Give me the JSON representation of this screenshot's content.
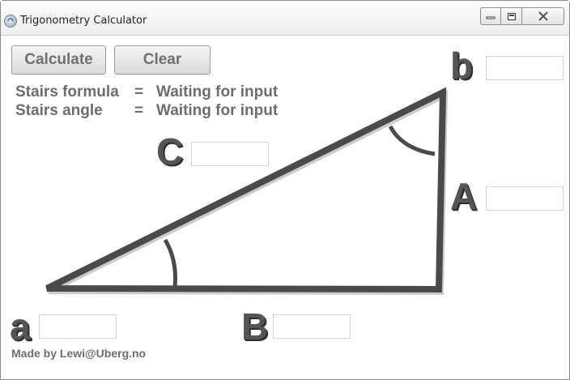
{
  "window": {
    "title": "Trigonometry Calculator",
    "icons": {
      "app": "calculator-app-icon",
      "minimize": "minimize-icon",
      "maximize": "maximize-icon",
      "close": "close-icon"
    }
  },
  "toolbar": {
    "calculate_label": "Calculate",
    "clear_label": "Clear"
  },
  "results": {
    "formula_label": "Stairs formula",
    "formula_value": "Waiting for input",
    "angle_label": "Stairs angle",
    "angle_value": "Waiting for input",
    "equals": "="
  },
  "labels": {
    "b": "b",
    "C": "C",
    "A": "A",
    "a": "a",
    "B": "B"
  },
  "inputs": {
    "b": "",
    "C": "",
    "A": "",
    "a": "",
    "B": ""
  },
  "footer": {
    "credit": "Made by Lewi@Uberg.no"
  },
  "colors": {
    "triangle": "#4a4a4a",
    "text": "#6d6d6d"
  }
}
